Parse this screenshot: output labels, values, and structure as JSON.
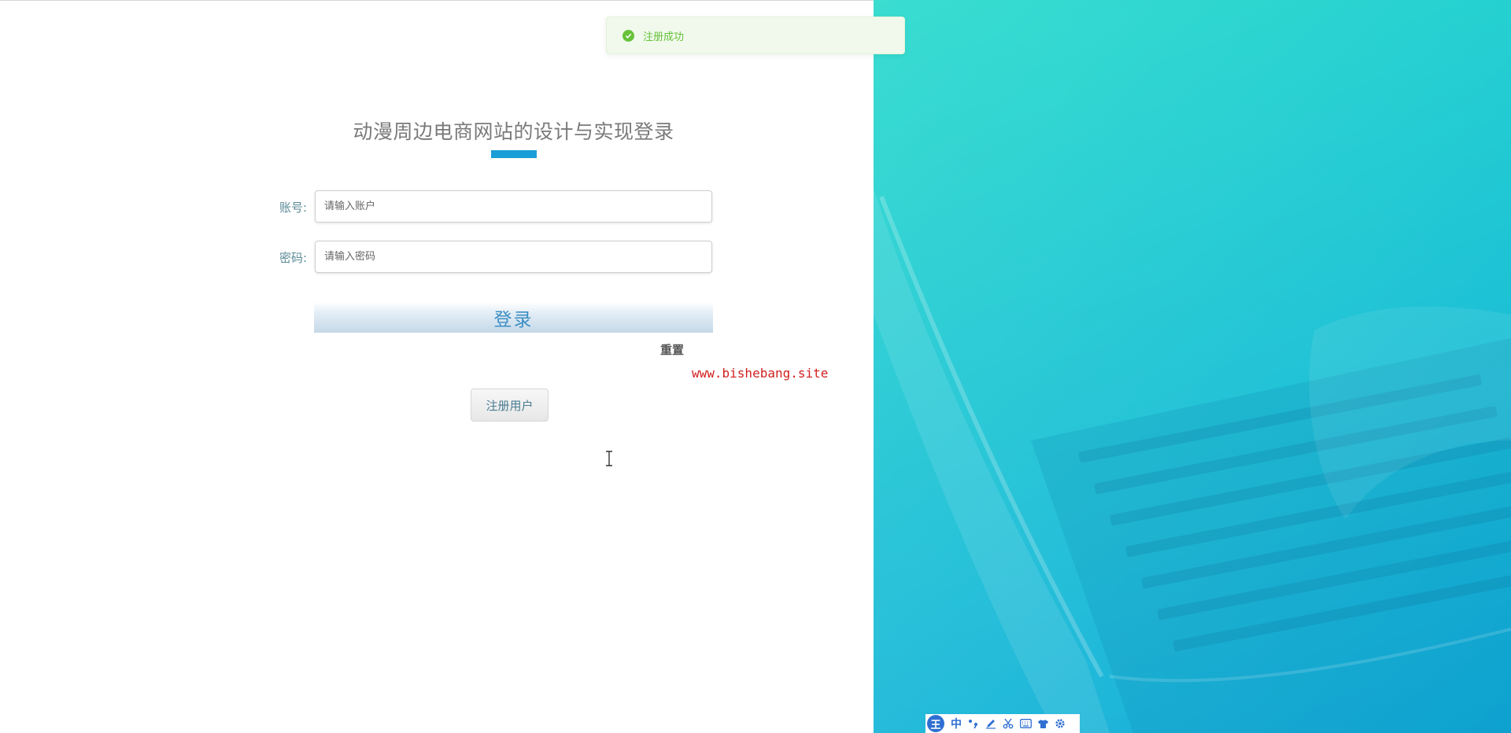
{
  "toast": {
    "message": "注册成功",
    "icon": "check-circle-icon",
    "color": "#67c23a"
  },
  "login": {
    "title": "动漫周边电商网站的设计与实现登录",
    "accent_color": "#1a9ed7",
    "account_label": "账号:",
    "account_placeholder": "请输入账户",
    "password_label": "密码:",
    "password_placeholder": "请输入密码",
    "login_button": "登录",
    "reset_link": "重置",
    "register_button": "注册用户"
  },
  "watermark": "www.bishebang.site",
  "ime_toolbar": {
    "logo": "王",
    "mode": "中",
    "items": [
      "punctuation-icon",
      "pen-icon",
      "scissors-icon",
      "keyboard-icon",
      "skin-icon",
      "settings-icon"
    ]
  }
}
